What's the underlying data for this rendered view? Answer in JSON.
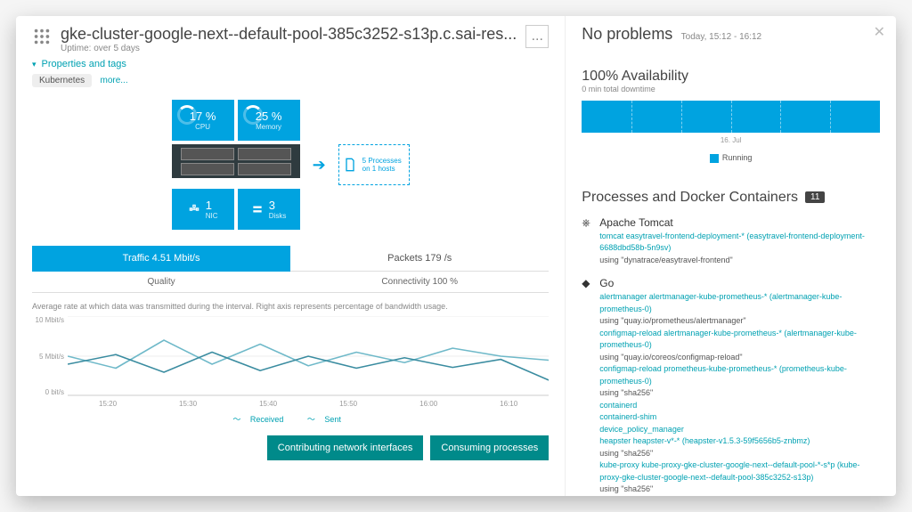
{
  "header": {
    "title": "gke-cluster-google-next--default-pool-385c3252-s13p.c.sai-res...",
    "uptime": "Uptime: over 5 days",
    "menu_icon": "..."
  },
  "props": {
    "label": "Properties and tags",
    "tag": "Kubernetes",
    "more": "more..."
  },
  "tiles": {
    "cpu_value": "17 %",
    "cpu_label": "CPU",
    "mem_value": "25 %",
    "mem_label": "Memory",
    "nic_value": "1",
    "nic_label": "NIC",
    "disks_value": "3",
    "disks_label": "Disks",
    "proc_box": "5 Processes on 1 hosts"
  },
  "tabs": {
    "traffic": "Traffic 4.51 Mbit/s",
    "packets": "Packets 179 /s",
    "quality": "Quality",
    "connectivity": "Connectivity 100 %"
  },
  "chart": {
    "desc": "Average rate at which data was transmitted during the interval. Right axis represents percentage of bandwidth usage.",
    "y": [
      "10 Mbit/s",
      "5 Mbit/s",
      "0 bit/s"
    ],
    "x": [
      "15:20",
      "15:30",
      "15:40",
      "15:50",
      "16:00",
      "16:10"
    ],
    "legend_received": "Received",
    "legend_sent": "Sent"
  },
  "chart_data": {
    "type": "line",
    "title": "Traffic",
    "ylabel": "Mbit/s",
    "ylim": [
      0,
      10
    ],
    "x": [
      "15:20",
      "15:25",
      "15:30",
      "15:35",
      "15:40",
      "15:45",
      "15:50",
      "15:55",
      "16:00",
      "16:05",
      "16:10"
    ],
    "series": [
      {
        "name": "Received",
        "values": [
          5.0,
          3.5,
          7.0,
          4.0,
          6.5,
          3.8,
          5.5,
          4.2,
          6.0,
          5.0,
          4.5
        ]
      },
      {
        "name": "Sent",
        "values": [
          4.0,
          5.2,
          3.0,
          5.5,
          3.2,
          5.0,
          3.5,
          4.8,
          3.6,
          4.6,
          2.0
        ]
      }
    ]
  },
  "buttons": {
    "contrib": "Contributing network interfaces",
    "consuming": "Consuming processes"
  },
  "problems": {
    "title": "No problems",
    "range": "Today, 15:12 - 16:12"
  },
  "availability": {
    "title": "100% Availability",
    "subtitle": "0 min total downtime",
    "xlabel": "16. Jul",
    "legend": "Running"
  },
  "processes": {
    "title": "Processes and Docker Containers",
    "count": "11",
    "groups": [
      {
        "name": "Apache Tomcat",
        "items": [
          {
            "link": "tomcat easytravel-frontend-deployment-*",
            "paren": "(easytravel-frontend-deployment-6688dbd58b-5n9sv)"
          },
          {
            "plain": "using \"dynatrace/easytravel-frontend\""
          }
        ]
      },
      {
        "name": "Go",
        "items": [
          {
            "link": "alertmanager alertmanager-kube-prometheus-*",
            "paren": "(alertmanager-kube-prometheus-0)"
          },
          {
            "plain": "using \"quay.io/prometheus/alertmanager\""
          },
          {
            "link": "configmap-reload alertmanager-kube-prometheus-*",
            "paren": "(alertmanager-kube-prometheus-0)"
          },
          {
            "plain": "using \"quay.io/coreos/configmap-reload\""
          },
          {
            "link": "configmap-reload prometheus-kube-prometheus-*",
            "paren": "(prometheus-kube-prometheus-0)"
          },
          {
            "plain": "using \"sha256\""
          },
          {
            "link": "containerd"
          },
          {
            "link": "containerd-shim"
          },
          {
            "link": "device_policy_manager"
          },
          {
            "link": "heapster heapster-v*-*",
            "paren": "(heapster-v1.5.3-59f5656b5-znbmz)"
          },
          {
            "plain": "using \"sha256\""
          },
          {
            "link": "kube-proxy kube-proxy-gke-cluster-google-next--default-pool-*-s*p",
            "paren": "(kube-proxy-gke-cluster-google-next--default-pool-385c3252-s13p)"
          },
          {
            "plain": "using \"sha256\""
          }
        ]
      }
    ]
  }
}
